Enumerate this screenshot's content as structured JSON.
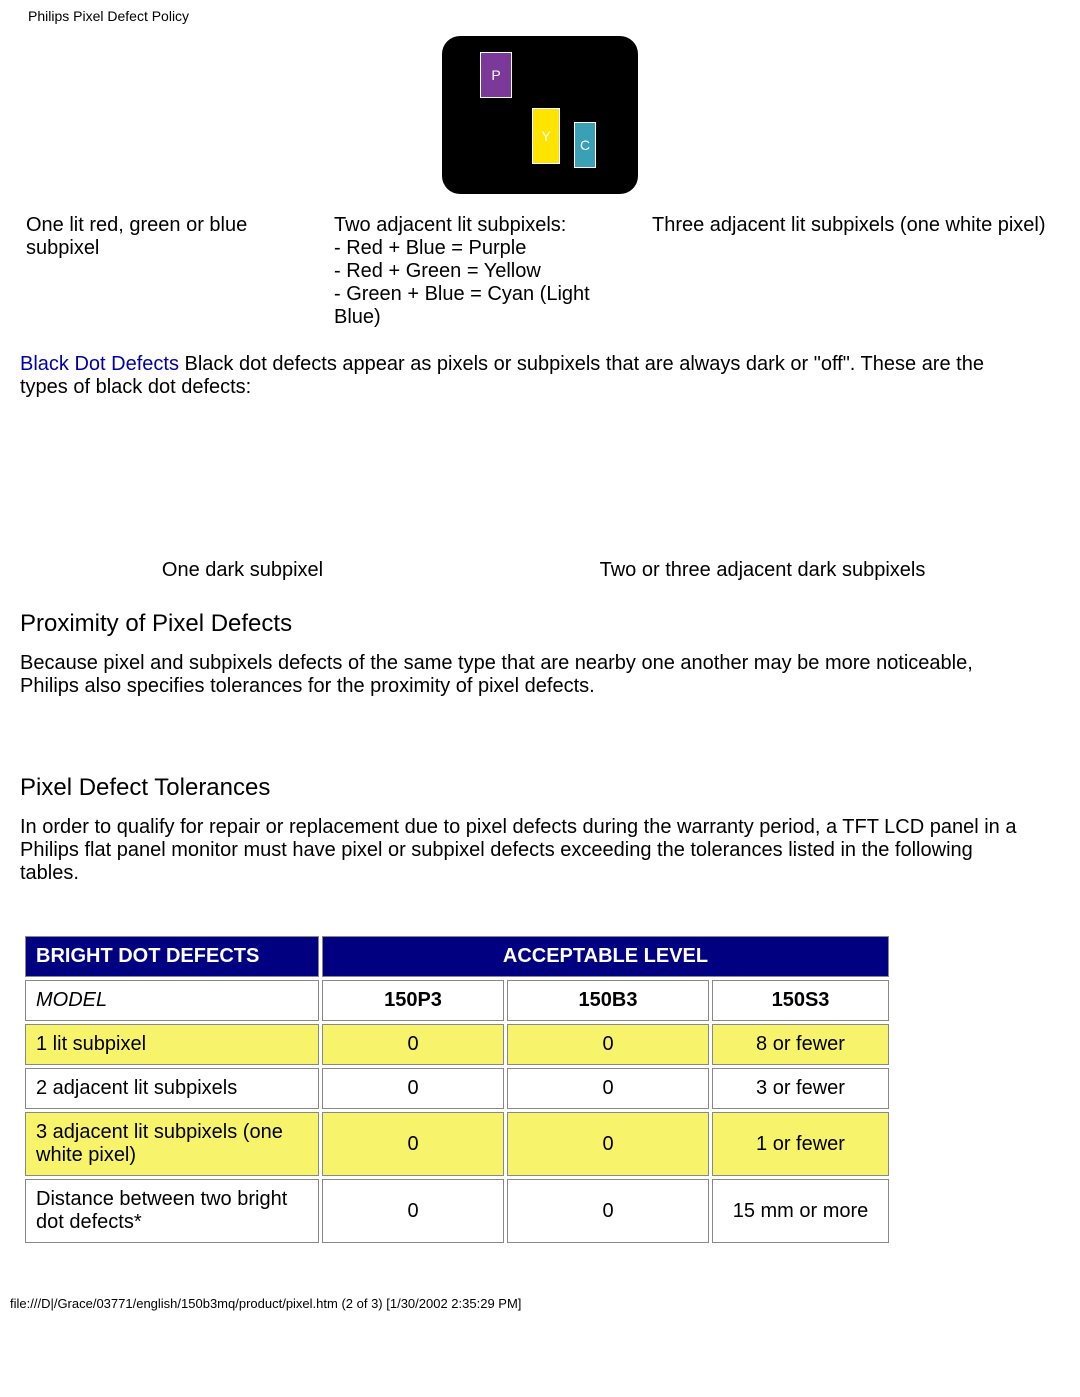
{
  "header_title": "Philips Pixel Defect Policy",
  "diagram_labels": {
    "p": "P",
    "y": "Y",
    "c": "C"
  },
  "captions": {
    "one_lit": "One lit red, green or blue subpixel",
    "two_adj_title": "Two adjacent lit subpixels:",
    "two_adj_l1": "- Red + Blue = Purple",
    "two_adj_l2": "- Red + Green = Yellow",
    "two_adj_l3": "- Green + Blue = Cyan (Light Blue)",
    "three_adj": "Three adjacent lit subpixels (one white pixel)"
  },
  "black_dot": {
    "title": "Black Dot Defects",
    "text": " Black dot defects appear as pixels or subpixels that are always dark or \"off\". These are the types of black dot defects:"
  },
  "dark_captions": {
    "one": "One dark subpixel",
    "two_three": "Two or three adjacent dark subpixels"
  },
  "proximity": {
    "title": "Proximity of Pixel Defects",
    "text": "Because pixel and subpixels defects of the same type that are nearby one another may be more noticeable, Philips also specifies tolerances for the proximity of pixel defects."
  },
  "tolerances": {
    "title": "Pixel Defect Tolerances",
    "text": "In order to qualify for repair or replacement due to pixel defects during the warranty period, a TFT LCD panel in a Philips flat panel monitor must have pixel or subpixel defects exceeding the tolerances listed in the following tables."
  },
  "table": {
    "bright_header": "BRIGHT DOT DEFECTS",
    "acceptable_header": "ACCEPTABLE LEVEL",
    "model_label": "MODEL",
    "models": [
      "150P3",
      "150B3",
      "150S3"
    ],
    "rows": [
      {
        "label": "1 lit subpixel",
        "vals": [
          "0",
          "0",
          "8 or fewer"
        ],
        "hl": true
      },
      {
        "label": "2 adjacent lit subpixels",
        "vals": [
          "0",
          "0",
          "3 or fewer"
        ],
        "hl": false
      },
      {
        "label": "3 adjacent lit subpixels (one white pixel)",
        "vals": [
          "0",
          "0",
          "1 or fewer"
        ],
        "hl": true
      },
      {
        "label": "Distance between two bright dot defects*",
        "vals": [
          "0",
          "0",
          "15 mm or more"
        ],
        "hl": false
      }
    ]
  },
  "footer": "file:///D|/Grace/03771/english/150b3mq/product/pixel.htm (2 of 3) [1/30/2002 2:35:29 PM]"
}
